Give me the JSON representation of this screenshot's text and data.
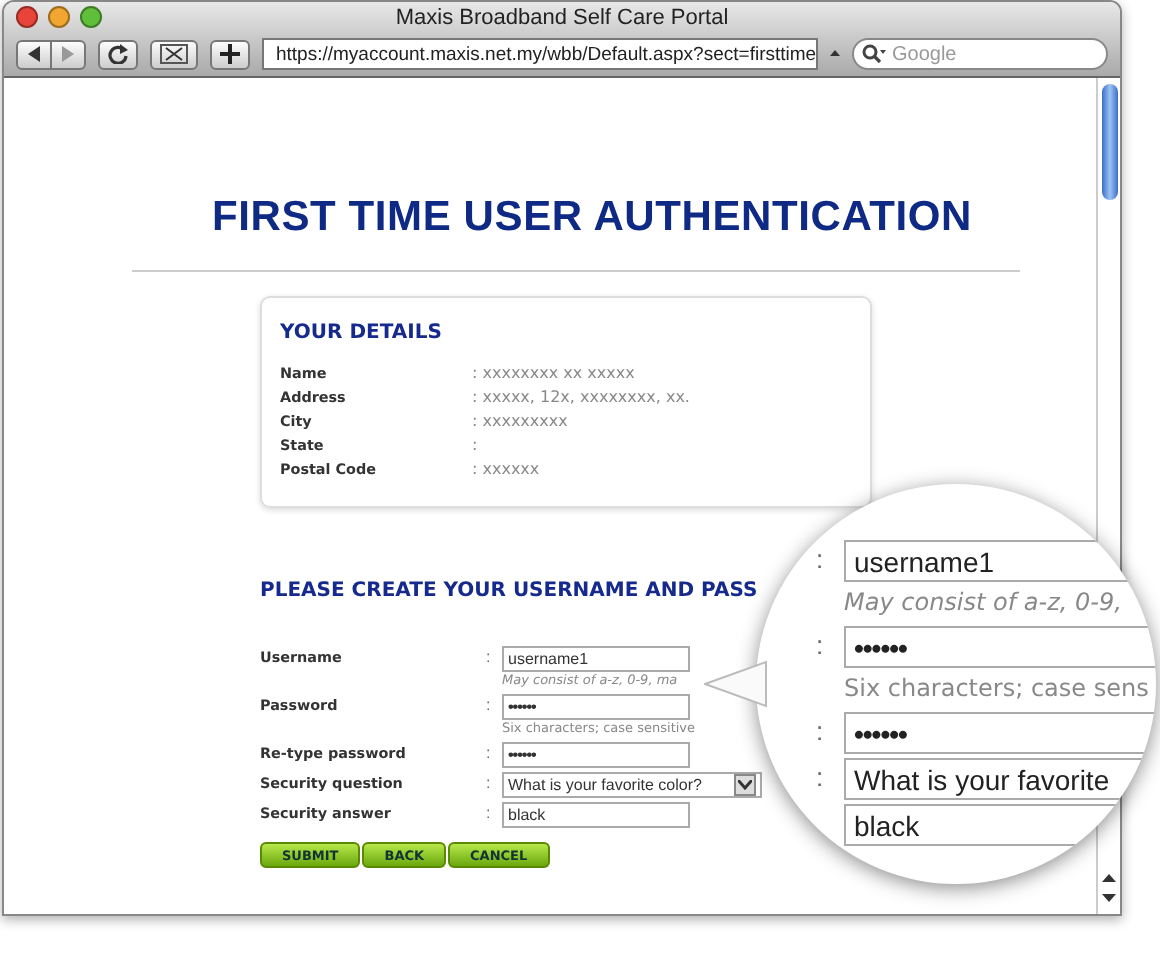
{
  "window": {
    "title": "Maxis Broadband Self Care Portal"
  },
  "toolbar": {
    "url": "https://myaccount.maxis.net.my/wbb/Default.aspx?sect=firsttime",
    "search_placeholder": "Google"
  },
  "heading": "FIRST TIME USER AUTHENTICATION",
  "details": {
    "title": "YOUR DETAILS",
    "rows": [
      {
        "label": "Name",
        "value": ": xxxxxxxx xx xxxxx"
      },
      {
        "label": "Address",
        "value": ": xxxxx, 12x, xxxxxxxx, xx."
      },
      {
        "label": "City",
        "value": ": xxxxxxxxx"
      },
      {
        "label": "State",
        "value": ":"
      },
      {
        "label": "Postal Code",
        "value": ": xxxxxx"
      }
    ]
  },
  "form": {
    "title": "PLEASE CREATE YOUR USERNAME AND PASS",
    "fields": [
      {
        "label": "Username",
        "colon": ":",
        "kind": "text",
        "value": "username1",
        "hint": "May consist of a-z, 0-9, ma"
      },
      {
        "label": "Password",
        "colon": ":",
        "kind": "password",
        "value": "••••••",
        "hint": "Six characters; case sensitive"
      },
      {
        "label": "Re-type password",
        "colon": ":",
        "kind": "password",
        "value": "••••••"
      },
      {
        "label": "Security question",
        "colon": ":",
        "kind": "select",
        "value": "What is your favorite color?"
      },
      {
        "label": "Security answer",
        "colon": ":",
        "kind": "text",
        "value": "black"
      }
    ],
    "buttons": [
      "SUBMIT",
      "BACK",
      "CANCEL"
    ]
  },
  "magnifier": {
    "rows": [
      {
        "colon": ":",
        "kind": "text",
        "value": "username1",
        "hint": "May consist of a-z, 0-9,"
      },
      {
        "colon": ":",
        "kind": "password",
        "value": "••••••",
        "hint": "Six characters; case sens"
      },
      {
        "colon": ":",
        "kind": "password",
        "value": "••••••"
      },
      {
        "colon": ":",
        "kind": "select",
        "value": "What is your favorite"
      },
      {
        "kind": "text",
        "value": "black"
      }
    ]
  }
}
